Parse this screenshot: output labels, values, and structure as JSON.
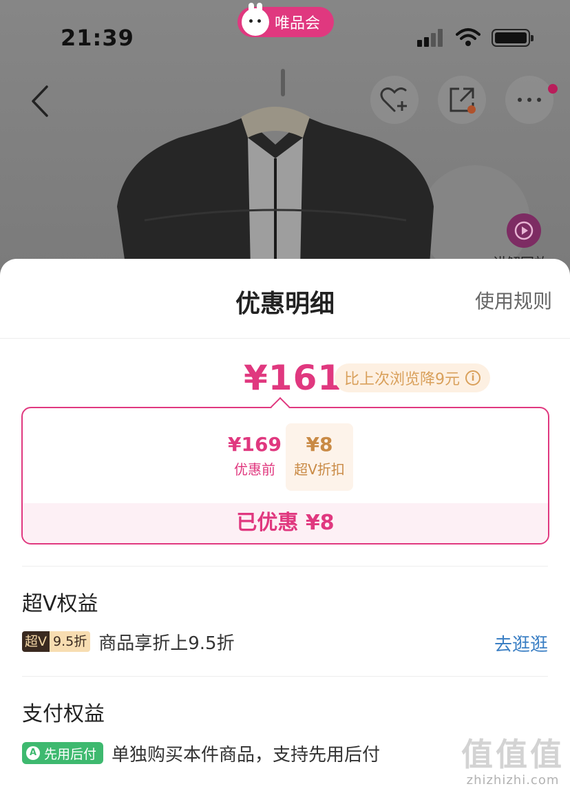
{
  "status_bar": {
    "time": "21:39"
  },
  "brand": {
    "name": "唯品会"
  },
  "background": {
    "live_label": "讲解回放"
  },
  "sheet": {
    "title": "优惠明细",
    "rules_link": "使用规则",
    "final_price": "¥161",
    "price_drop_text": "比上次浏览降9元",
    "calc": {
      "original_amount": "¥169",
      "original_label": "优惠前",
      "operator": "-",
      "discount_amount": "¥8",
      "discount_label": "超V折扣",
      "saved_text": "已优惠 ¥8"
    },
    "svip_section": {
      "title": "超V权益",
      "badge_left": "超V",
      "badge_right": "9.5折",
      "text": "商品享折上9.5折",
      "link": "去逛逛"
    },
    "pay_section": {
      "title": "支付权益",
      "badge": "先用后付",
      "text": "单独购买本件商品，支持先用后付"
    }
  },
  "watermark": {
    "big": "值值值",
    "small": "zhizhizhi.com"
  },
  "colors": {
    "accent": "#e0387f",
    "gold": "#c98a45",
    "link": "#3b7fc4",
    "pay_green": "#3eb96f"
  }
}
